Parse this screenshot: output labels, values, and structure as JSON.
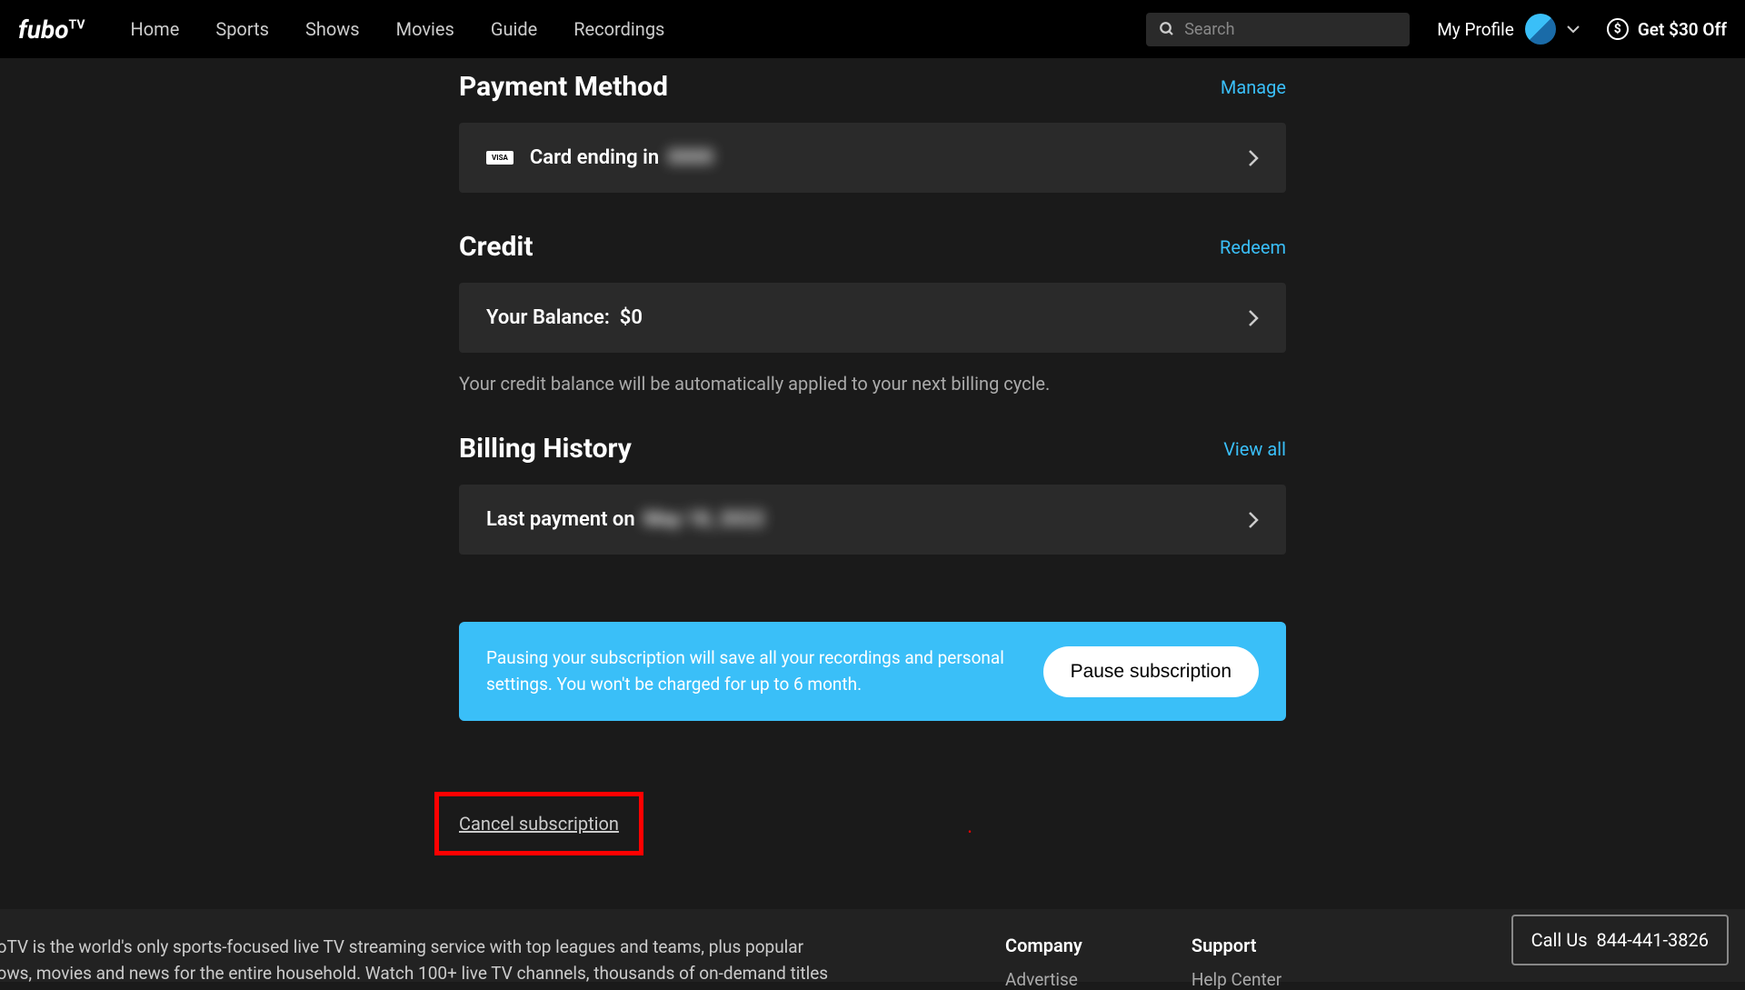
{
  "header": {
    "logo": "fuboTV",
    "nav": [
      "Home",
      "Sports",
      "Shows",
      "Movies",
      "Guide",
      "Recordings"
    ],
    "search_placeholder": "Search",
    "profile_label": "My Profile",
    "promo_label": "Get $30 Off"
  },
  "payment": {
    "title": "Payment Method",
    "link": "Manage",
    "card_label": "Card ending in",
    "card_last4": "0000"
  },
  "credit": {
    "title": "Credit",
    "link": "Redeem",
    "balance_label": "Your Balance:",
    "balance_value": "$0",
    "helper": "Your credit balance will be automatically applied to your next billing cycle."
  },
  "billing": {
    "title": "Billing History",
    "link": "View all",
    "last_payment_label": "Last payment on",
    "last_payment_date": "May 18, 2022"
  },
  "pause": {
    "text": "Pausing your subscription will save all your recordings and personal settings. You won't be charged for up to 6 month.",
    "button": "Pause subscription"
  },
  "cancel": {
    "label": "Cancel subscription"
  },
  "footer": {
    "desc": "boTV is the world's only sports-focused live TV streaming service with top leagues and teams, plus popular nows, movies and news for the entire household. Watch 100+ live TV channels, thousands of on-demand titles",
    "company_heading": "Company",
    "company_link": "Advertise",
    "support_heading": "Support",
    "support_link": "Help Center",
    "call_label": "Call Us",
    "call_number": "844-441-3826"
  }
}
